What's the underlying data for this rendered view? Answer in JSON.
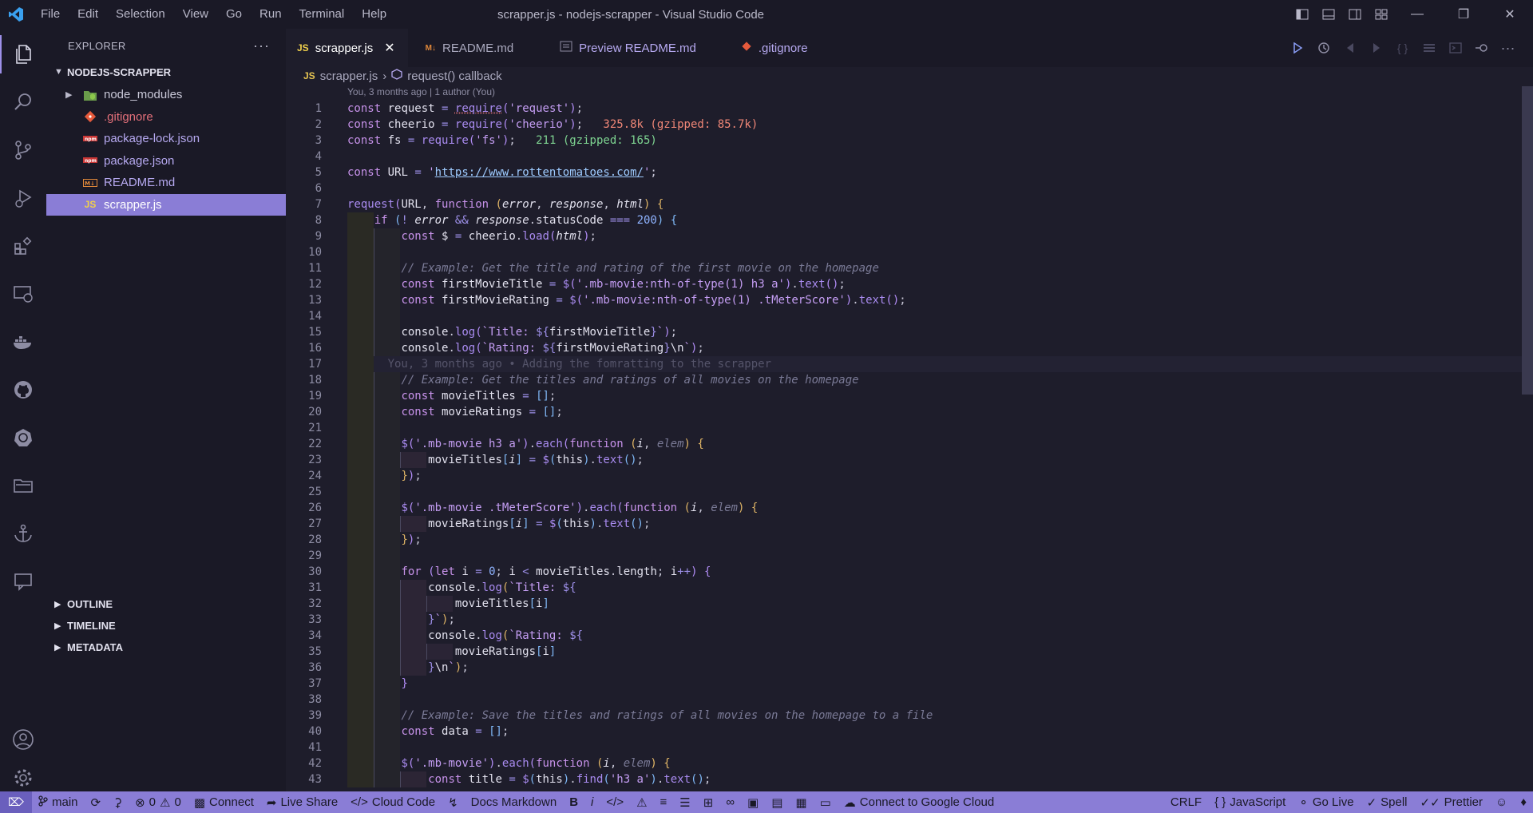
{
  "window": {
    "title": "scrapper.js - nodejs-scrapper - Visual Studio Code"
  },
  "menu": [
    "File",
    "Edit",
    "Selection",
    "View",
    "Go",
    "Run",
    "Terminal",
    "Help"
  ],
  "sidebar": {
    "header": "EXPLORER",
    "project": "NODEJS-SCRAPPER",
    "files": [
      {
        "name": "node_modules",
        "icon": "nodejs-folder-icon",
        "type": "folder"
      },
      {
        "name": ".gitignore",
        "icon": "git-icon",
        "type": "file"
      },
      {
        "name": "package-lock.json",
        "icon": "npm-icon",
        "type": "file"
      },
      {
        "name": "package.json",
        "icon": "npm-icon",
        "type": "file"
      },
      {
        "name": "README.md",
        "icon": "markdown-icon",
        "type": "file"
      },
      {
        "name": "scrapper.js",
        "icon": "javascript-icon",
        "type": "file",
        "selected": true
      }
    ],
    "bottom_sections": [
      "OUTLINE",
      "TIMELINE",
      "METADATA"
    ]
  },
  "tabs": [
    {
      "label": "scrapper.js",
      "icon": "JS",
      "active": true
    },
    {
      "label": "README.md",
      "icon": "M↓"
    },
    {
      "label": "Preview README.md",
      "icon": "preview"
    },
    {
      "label": ".gitignore",
      "icon": "git"
    }
  ],
  "breadcrumb": {
    "file": "scrapper.js",
    "symbol": "request() callback",
    "file_icon": "JS"
  },
  "author_line": "You, 3 months ago | 1 author (You)",
  "blame": "You, 3 months ago • Adding the fomratting to the scrapper",
  "import_sizes": {
    "cheerio": "325.8k (gzipped: 85.7k)",
    "fs": "211 (gzipped: 165)"
  },
  "url_value": "https://www.rottentomatoes.com/",
  "statusbar": {
    "branch": "main",
    "errors": "0",
    "warnings": "0",
    "connect": "Connect",
    "live_share": "Live Share",
    "cloud_code": "Cloud Code",
    "docs_markdown": "Docs Markdown",
    "bold": "B",
    "italic": "i",
    "google_cloud": "Connect to Google Cloud",
    "eol": "CRLF",
    "language": "JavaScript",
    "go_live": "Go Live",
    "spell": "Spell",
    "prettier": "Prettier"
  },
  "colors": {
    "accent": "#8a7dd6",
    "background": "#1e1d2b",
    "sidebar": "#1a1926"
  },
  "line_count": 43
}
